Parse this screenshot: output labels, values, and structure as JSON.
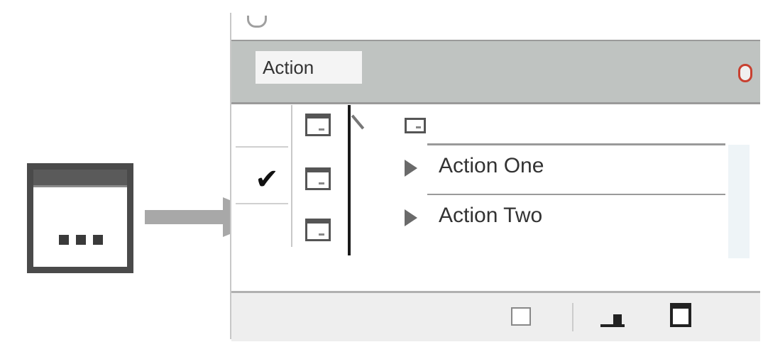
{
  "panel": {
    "title": "Action"
  },
  "actions": [
    {
      "label": "Action One"
    },
    {
      "label": "Action Two"
    }
  ],
  "checkmark": "✔",
  "icons": {
    "dialog_toggle": "dialog-toggle-icon",
    "panel_menu": "panel-menu-icon",
    "expand": "expand-triangle-icon",
    "new_set": "new-set-icon",
    "new_action": "new-action-icon"
  },
  "colors": {
    "header": "#bfc3c1",
    "accent_menu": "#c84030",
    "arrow": "#a8a8a8"
  }
}
